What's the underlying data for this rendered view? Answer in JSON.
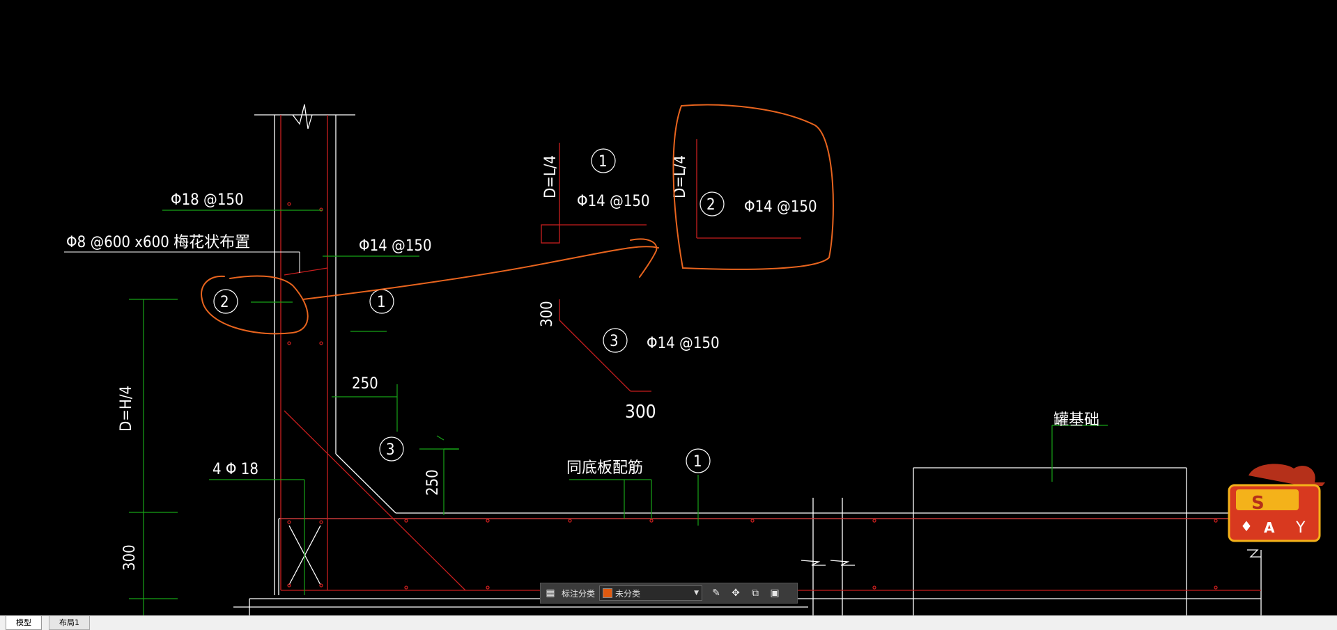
{
  "drawing": {
    "labels": {
      "rebar_18_150": "Φ18 @150",
      "rebar_8_600": "Φ8 @600 x600  梅花状布置",
      "rebar_14_150_a": "Φ14 @150",
      "rebar_14_150_b": "Φ14 @150",
      "rebar_14_150_c": "Φ14 @150",
      "rebar_14_150_d": "Φ14 @150",
      "dim_dl4_a": "D=L/4",
      "dim_dl4_b": "D=L/4",
      "dim_dh4": "D=H/4",
      "dim_300_a": "300",
      "dim_300_b": "300",
      "dim_300_c": "300",
      "dim_250_a": "250",
      "dim_250_b": "250",
      "rebar_4_18": "4 Φ 18",
      "same_as_bottom": "同底板配筋",
      "tank_foundation": "罐基础",
      "marker_1": "1",
      "marker_2": "2",
      "marker_3": "3"
    }
  },
  "toolbar": {
    "label": "标注分类",
    "select_value": "未分类",
    "swatch_color": "#e05a10",
    "icons": [
      "grid-icon",
      "edit-icon",
      "move-icon",
      "copy-icon",
      "paste-icon"
    ]
  },
  "tabs": {
    "model": "模型",
    "layout1": "布局1"
  },
  "colors": {
    "background": "#000000",
    "rebar_red": "#c81e1e",
    "dimension_green": "#17a317",
    "annotation_orange": "#e8641e",
    "line_white": "#ffffff"
  }
}
